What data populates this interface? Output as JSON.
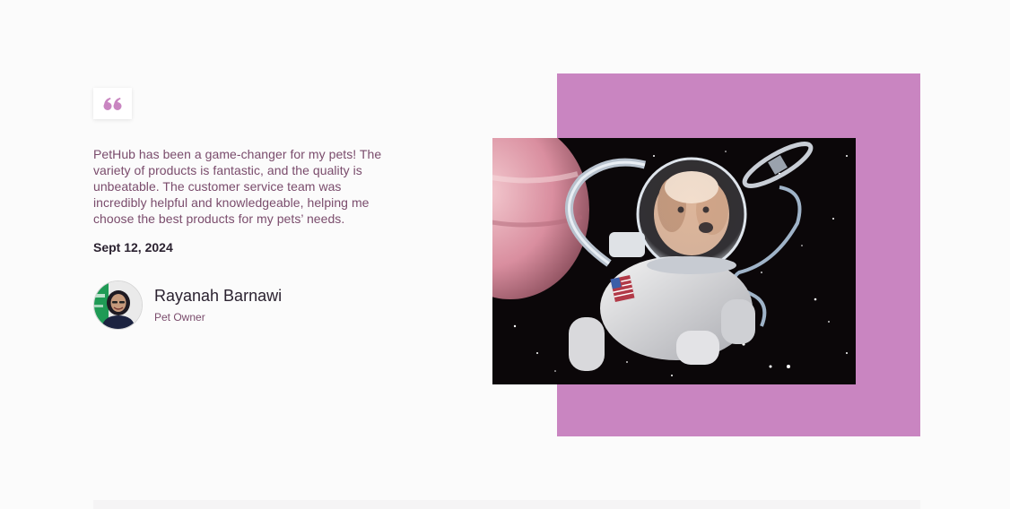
{
  "testimonial": {
    "quote_icon": "quote-mark-icon",
    "text": "PetHub has been a game-changer for my pets! The variety of products is fantastic, and the quality is unbeatable. The customer service team was incredibly helpful and knowledgeable, helping me choose the best products for my pets’ needs.",
    "date": "Sept 12, 2024",
    "author": {
      "name": "Rayanah Barnawi",
      "role": "Pet Owner",
      "avatar": "avatar-photo"
    }
  },
  "image": {
    "subject": "dog-in-spacesuit-photo"
  },
  "colors": {
    "accent": "#c985c1",
    "text_muted": "#7a4c6c",
    "text_dark": "#2b2230",
    "background": "#fbfbfb"
  }
}
